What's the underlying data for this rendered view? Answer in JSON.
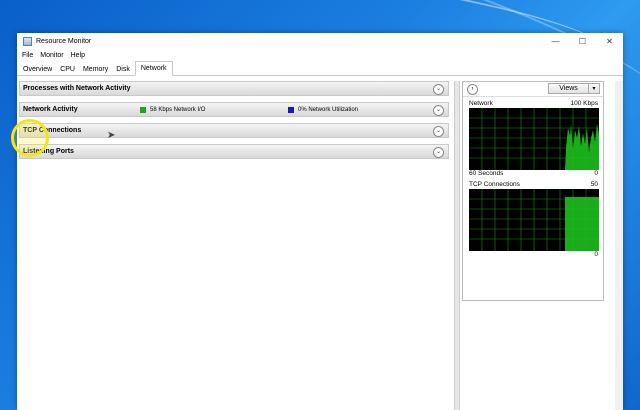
{
  "window": {
    "title": "Resource Monitor",
    "controls": {
      "minimize": "—",
      "maximize": "☐",
      "close": "✕"
    }
  },
  "menu": [
    "File",
    "Monitor",
    "Help"
  ],
  "tabs": [
    "Overview",
    "CPU",
    "Memory",
    "Disk",
    "Network"
  ],
  "active_tab": "Network",
  "sections": [
    {
      "title": "Processes with Network Activity"
    },
    {
      "title": "Network Activity",
      "legend": [
        {
          "text": "58 Kbps Network I/O",
          "color": "#1aa81a"
        },
        {
          "text": "0% Network Utilization",
          "color": "#1a1aa8"
        }
      ]
    },
    {
      "title": "TCP Connections"
    },
    {
      "title": "Listening Ports"
    }
  ],
  "right_pane": {
    "views_label": "Views",
    "network_graph": {
      "title": "Network",
      "max_label": "100 Kbps",
      "time_label": "60 Seconds",
      "min_label": "0"
    },
    "tcp_graph": {
      "title": "TCP Connections",
      "max_label": "50",
      "min_label": "0"
    }
  },
  "colors": {
    "graph_bg": "#000000",
    "graph_grid": "#1f8a1f",
    "graph_fill": "#1dbf1d",
    "accent": "#0a5fc8"
  }
}
